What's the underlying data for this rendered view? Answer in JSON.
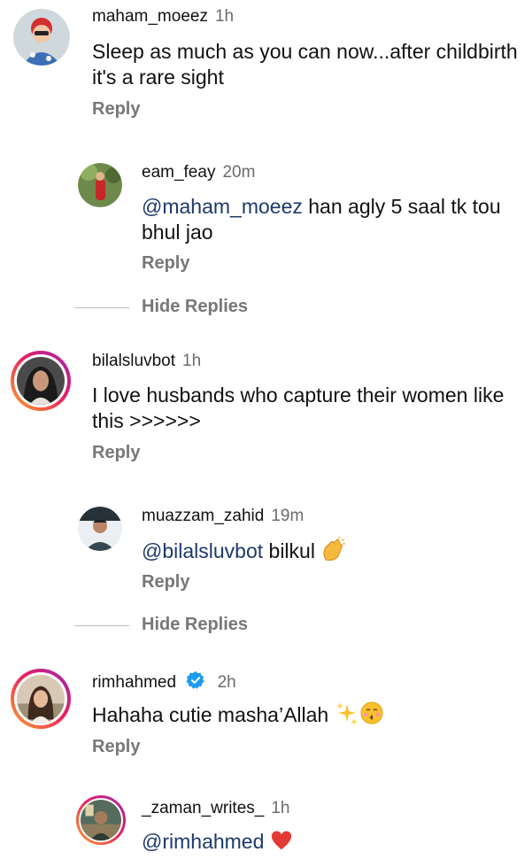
{
  "comments": [
    {
      "username": "maham_moeez",
      "time": "1h",
      "text": "Sleep as much as you can now...after childbirth it's a rare sight",
      "reply_label": "Reply"
    },
    {
      "username": "eam_feay",
      "time": "20m",
      "mention": "@maham_moeez",
      "text": " han agly 5 saal tk tou bhul jao",
      "reply_label": "Reply"
    },
    {
      "username": "bilalsluvbot",
      "time": "1h",
      "text": "I love husbands who capture their women like this >>>>>>",
      "reply_label": "Reply"
    },
    {
      "username": "muazzam_zahid",
      "time": "19m",
      "mention": "@bilalsluvbot",
      "text": " bilkul",
      "emoji": "clapping-hands-icon",
      "reply_label": "Reply"
    },
    {
      "username": "rimhahmed",
      "time": "2h",
      "text": "Hahaha cutie masha’Allah",
      "emoji": "sparkles-and-kissing-face-icon",
      "reply_label": "Reply"
    },
    {
      "username": "_zaman_writes_",
      "time": "1h",
      "mention": "@rimhahmed",
      "emoji": "red-heart-icon"
    }
  ],
  "hide_replies_label": "Hide Replies",
  "colors": {
    "mention": "#1d3a6b",
    "meta_gray": "#6b6b6b",
    "story_ring_start": "#f9a825",
    "story_ring_mid": "#e91e63",
    "story_ring_end": "#9c27b0",
    "verified": "#1d9bf0"
  }
}
